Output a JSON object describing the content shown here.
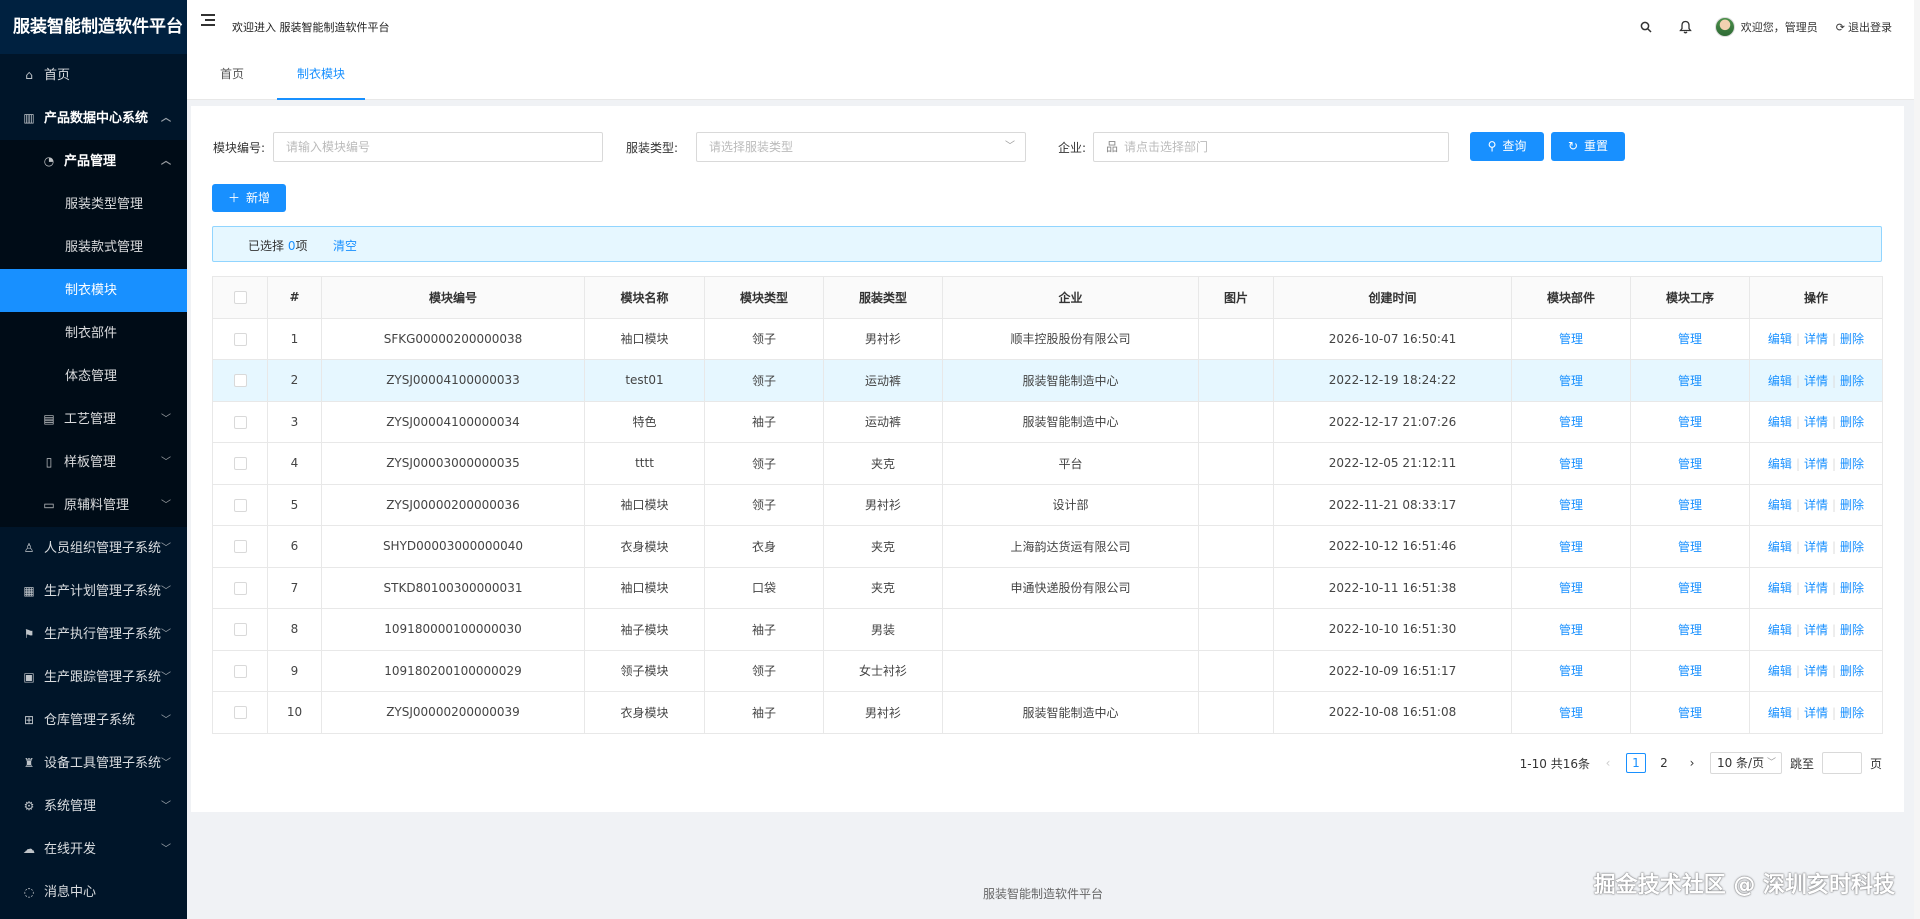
{
  "app": {
    "title": "服装智能制造软件平台",
    "welcome": "欢迎进入 服装智能制造软件平台"
  },
  "header": {
    "user_label": "欢迎您，管理员",
    "logout_label": "退出登录",
    "icons": [
      "search-icon",
      "bell-icon",
      "avatar",
      "logout-icon"
    ]
  },
  "sidebar": {
    "items": [
      {
        "label": "首页",
        "icon": "home-icon"
      },
      {
        "label": "产品数据中心系统",
        "icon": "bank-icon"
      },
      {
        "label": "产品管理",
        "icon": "pie-icon"
      },
      {
        "label": "服装类型管理"
      },
      {
        "label": "服装款式管理"
      },
      {
        "label": "制衣模块"
      },
      {
        "label": "制衣部件"
      },
      {
        "label": "体态管理"
      },
      {
        "label": "工艺管理",
        "icon": "file-icon"
      },
      {
        "label": "样板管理",
        "icon": "trash-icon"
      },
      {
        "label": "原辅料管理",
        "icon": "card-icon"
      },
      {
        "label": "人员组织管理子系统",
        "icon": "user-icon"
      },
      {
        "label": "生产计划管理子系统",
        "icon": "doc-icon"
      },
      {
        "label": "生产执行管理子系统",
        "icon": "flag-icon"
      },
      {
        "label": "生产跟踪管理子系统",
        "icon": "monitor-icon"
      },
      {
        "label": "仓库管理子系统",
        "icon": "grid-icon"
      },
      {
        "label": "设备工具管理子系统",
        "icon": "tool-icon"
      },
      {
        "label": "系统管理",
        "icon": "gear-icon"
      },
      {
        "label": "在线开发",
        "icon": "cloud-icon"
      },
      {
        "label": "消息中心",
        "icon": "message-icon"
      }
    ]
  },
  "tabs": [
    {
      "label": "首页"
    },
    {
      "label": "制衣模块"
    }
  ],
  "search": {
    "module_code_label": "模块编号:",
    "module_code_placeholder": "请输入模块编号",
    "type_label": "服装类型:",
    "type_placeholder": "请选择服装类型",
    "company_label": "企业:",
    "company_placeholder": "请点击选择部门",
    "query_label": "查询",
    "reset_label": "重置",
    "add_label": "新增"
  },
  "selection": {
    "prefix": "已选择",
    "count": "0",
    "suffix": "项",
    "clear_label": "清空"
  },
  "table": {
    "columns": [
      "#",
      "模块编号",
      "模块名称",
      "模块类型",
      "服装类型",
      "企业",
      "图片",
      "创建时间",
      "模块部件",
      "模块工序",
      "操作"
    ],
    "manage_label": "管理",
    "edit_label": "编辑",
    "detail_label": "详情",
    "delete_label": "删除",
    "rows": [
      {
        "no": "1",
        "code": "SFKG00000200000038",
        "name": "袖口模块",
        "mtype": "领子",
        "ctype": "男衬衫",
        "company": "顺丰控股股份有限公司",
        "time": "2026-10-07 16:50:41"
      },
      {
        "no": "2",
        "code": "ZYSJ00004100000033",
        "name": "test01",
        "mtype": "领子",
        "ctype": "运动裤",
        "company": "服装智能制造中心",
        "time": "2022-12-19 18:24:22"
      },
      {
        "no": "3",
        "code": "ZYSJ00004100000034",
        "name": "特色",
        "mtype": "袖子",
        "ctype": "运动裤",
        "company": "服装智能制造中心",
        "time": "2022-12-17 21:07:26"
      },
      {
        "no": "4",
        "code": "ZYSJ00003000000035",
        "name": "tttt",
        "mtype": "领子",
        "ctype": "夹克",
        "company": "平台",
        "time": "2022-12-05 21:12:11"
      },
      {
        "no": "5",
        "code": "ZYSJ00000200000036",
        "name": "袖口模块",
        "mtype": "领子",
        "ctype": "男衬衫",
        "company": "设计部",
        "time": "2022-11-21 08:33:17"
      },
      {
        "no": "6",
        "code": "SHYD00003000000040",
        "name": "衣身模块",
        "mtype": "衣身",
        "ctype": "夹克",
        "company": "上海韵达货运有限公司",
        "time": "2022-10-12 16:51:46"
      },
      {
        "no": "7",
        "code": "STKD80100300000031",
        "name": "袖口模块",
        "mtype": "口袋",
        "ctype": "夹克",
        "company": "申通快递股份有限公司",
        "time": "2022-10-11 16:51:38"
      },
      {
        "no": "8",
        "code": "109180000100000030",
        "name": "袖子模块",
        "mtype": "袖子",
        "ctype": "男装",
        "company": "",
        "time": "2022-10-10 16:51:30"
      },
      {
        "no": "9",
        "code": "109180200100000029",
        "name": "领子模块",
        "mtype": "领子",
        "ctype": "女士衬衫",
        "company": "",
        "time": "2022-10-09 16:51:17"
      },
      {
        "no": "10",
        "code": "ZYSJ00000200000039",
        "name": "衣身模块",
        "mtype": "袖子",
        "ctype": "男衬衫",
        "company": "服装智能制造中心",
        "time": "2022-10-08 16:51:08"
      }
    ]
  },
  "pagination": {
    "summary": "1-10 共16条",
    "pages": [
      "1",
      "2"
    ],
    "current_page": "1",
    "page_size": "10 条/页",
    "jump_label": "跳至",
    "page_unit": "页"
  },
  "footer": {
    "text": "服装智能制造软件平台"
  },
  "watermark": {
    "text": "掘金技术社区 @ 深圳亥时科技"
  },
  "colors": {
    "primary": "#1890ff",
    "sidebar_bg": "#001529",
    "sidebar_sub_bg": "#000c17",
    "highlight_row": "#e6f7ff"
  }
}
